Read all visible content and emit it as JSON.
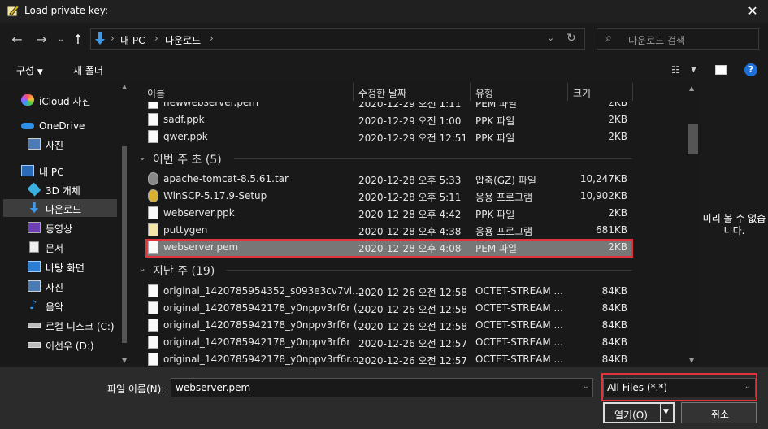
{
  "window": {
    "title": "Load private key:"
  },
  "address": {
    "crumbs": [
      "내 PC",
      "다운로드"
    ],
    "search_placeholder": "다운로드 검색"
  },
  "toolbar": {
    "organize": "구성",
    "new_folder": "새 폴더"
  },
  "sidebar": {
    "items": [
      {
        "label": "iCloud 사진",
        "icon": "icloud-photos-icon"
      },
      {
        "label": "OneDrive",
        "icon": "onedrive-icon"
      },
      {
        "label": "사진",
        "icon": "folder-pictures-icon"
      },
      {
        "label": "내 PC",
        "icon": "pc-icon"
      },
      {
        "label": "3D 개체",
        "icon": "3d-objects-icon"
      },
      {
        "label": "다운로드",
        "icon": "downloads-icon"
      },
      {
        "label": "동영상",
        "icon": "videos-icon"
      },
      {
        "label": "문서",
        "icon": "documents-icon"
      },
      {
        "label": "바탕 화면",
        "icon": "desktop-icon"
      },
      {
        "label": "사진",
        "icon": "pictures-icon"
      },
      {
        "label": "음악",
        "icon": "music-icon"
      },
      {
        "label": "로컬 디스크 (C:)",
        "icon": "drive-c-icon"
      },
      {
        "label": "이선우 (D:)",
        "icon": "drive-d-icon"
      }
    ]
  },
  "columns": {
    "name": "이름",
    "date": "수정한 날짜",
    "type": "유형",
    "size": "크기"
  },
  "groups": [
    {
      "label": "이번 주 초 (5)"
    },
    {
      "label": "지난 주 (19)"
    }
  ],
  "files_top": [
    {
      "name": "newwebserver.pem",
      "date": "2020-12-29 오전 1:11",
      "type": "PEM 파일",
      "size": "2KB"
    },
    {
      "name": "sadf.ppk",
      "date": "2020-12-29 오전 1:00",
      "type": "PPK 파일",
      "size": "2KB"
    },
    {
      "name": "qwer.ppk",
      "date": "2020-12-29 오전 12:51",
      "type": "PPK 파일",
      "size": "2KB"
    }
  ],
  "files_week": [
    {
      "name": "apache-tomcat-8.5.61.tar",
      "date": "2020-12-28 오후 5:33",
      "type": "압축(GZ) 파일",
      "size": "10,247KB"
    },
    {
      "name": "WinSCP-5.17.9-Setup",
      "date": "2020-12-28 오후 5:11",
      "type": "응용 프로그램",
      "size": "10,902KB"
    },
    {
      "name": "webserver.ppk",
      "date": "2020-12-28 오후 4:42",
      "type": "PPK 파일",
      "size": "2KB"
    },
    {
      "name": "puttygen",
      "date": "2020-12-28 오후 4:38",
      "type": "응용 프로그램",
      "size": "681KB"
    },
    {
      "name": "webserver.pem",
      "date": "2020-12-28 오후 4:08",
      "type": "PEM 파일",
      "size": "2KB"
    }
  ],
  "files_last_week": [
    {
      "name": "original_1420785954352_s093e3cv7vi....",
      "date": "2020-12-26 오전 12:58",
      "type": "OCTET-STREAM ...",
      "size": "84KB"
    },
    {
      "name": "original_1420785942178_y0nppv3rf6r (...",
      "date": "2020-12-26 오전 12:58",
      "type": "OCTET-STREAM ...",
      "size": "84KB"
    },
    {
      "name": "original_1420785942178_y0nppv3rf6r (...",
      "date": "2020-12-26 오전 12:58",
      "type": "OCTET-STREAM ...",
      "size": "84KB"
    },
    {
      "name": "original_1420785942178_y0nppv3rf6r",
      "date": "2020-12-26 오전 12:57",
      "type": "OCTET-STREAM ...",
      "size": "84KB"
    },
    {
      "name": "original_1420785942178_y0nppv3rf6r.o...",
      "date": "2020-12-26 오전 12:57",
      "type": "OCTET-STREAM ...",
      "size": "84KB"
    }
  ],
  "preview": {
    "message": "미리 볼 수 없습니다."
  },
  "bottom": {
    "filename_label": "파일 이름(N):",
    "filename_value": "webserver.pem",
    "filter_value": "All Files (*.*)",
    "open_label": "열기(O)",
    "cancel_label": "취소"
  },
  "colors": {
    "highlight": "#e0333c",
    "selected_row": "#777777",
    "background": "#191919"
  }
}
